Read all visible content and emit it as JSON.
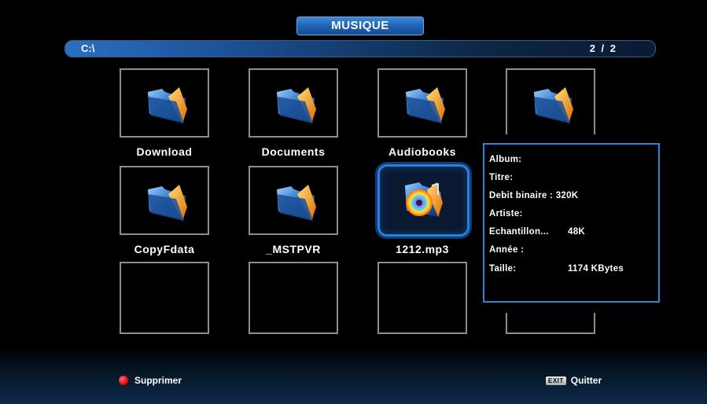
{
  "header": {
    "title": "MUSIQUE"
  },
  "path_bar": {
    "path": "C:\\",
    "page": "2 / 2"
  },
  "grid": {
    "items": [
      {
        "label": "Download",
        "type": "folder"
      },
      {
        "label": "Documents",
        "type": "folder"
      },
      {
        "label": "Audiobooks",
        "type": "folder"
      },
      {
        "label": "",
        "type": "folder"
      },
      {
        "label": "CopyFdata",
        "type": "folder"
      },
      {
        "label": "_MSTPVR",
        "type": "folder"
      },
      {
        "label": "1212.mp3",
        "type": "music",
        "selected": true
      }
    ]
  },
  "info": {
    "album_label": "Album:",
    "title_label": "Titre:",
    "bitrate_label": "Debit binaire :",
    "bitrate_value": "320K",
    "artist_label": "Artiste:",
    "sample_label": "Echantillon...",
    "sample_value": "48K",
    "year_label": "Année :",
    "size_label": "Taille:",
    "size_value": "1174 KBytes"
  },
  "footer": {
    "delete_label": "Supprimer",
    "exit_key": "EXIT",
    "exit_label": "Quitter"
  },
  "colors": {
    "accent": "#2a7fd6",
    "tile_border": "#8d8d8d",
    "delete_dot": "#d40000"
  }
}
